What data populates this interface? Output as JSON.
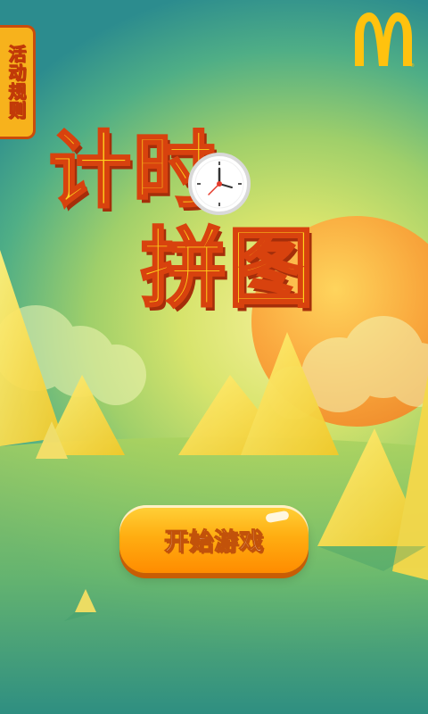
{
  "rules_tab": {
    "label": "活动规则"
  },
  "logo": {
    "icon": "mcdonalds-golden-arches-icon",
    "color": "#ffc20e"
  },
  "title": {
    "line1": "计时",
    "line2": "拼图"
  },
  "start_button": {
    "label": "开始游戏"
  },
  "colors": {
    "title_fill": "#ffd21d",
    "title_outline": "#d8420e",
    "button": "#ffae12",
    "sun": "#f9a436"
  }
}
